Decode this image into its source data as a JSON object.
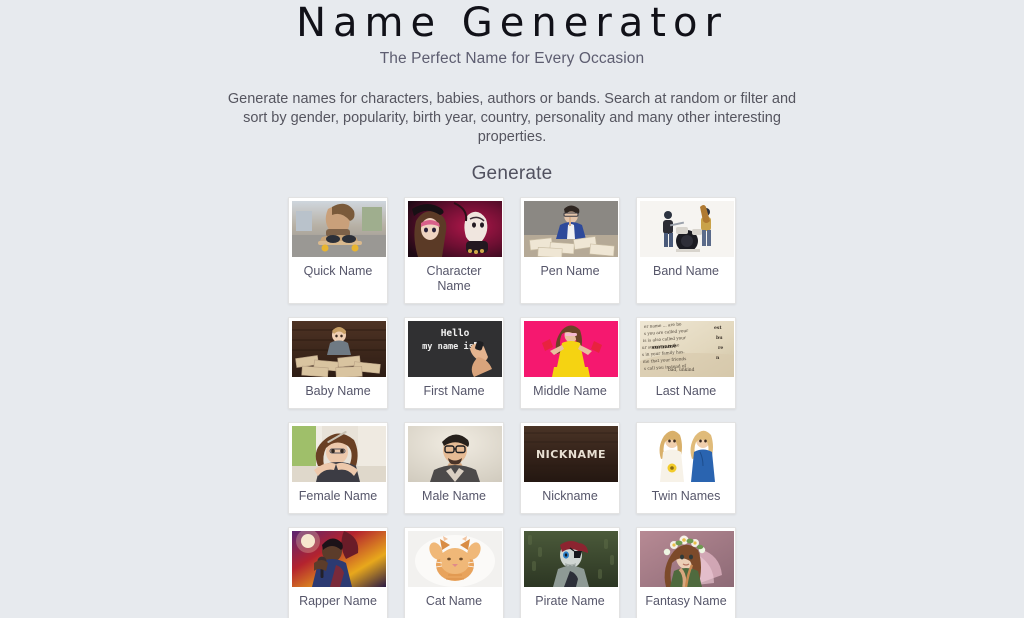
{
  "header": {
    "title": "Name Generator",
    "tagline": "The Perfect Name for Every Occasion",
    "intro": "Generate names for characters, babies, authors or bands. Search at random or filter and sort by gender, popularity, birth year, country, personality and many other interesting properties."
  },
  "section": {
    "title": "Generate"
  },
  "colors": {
    "page_background": "#e7eaee",
    "card_background": "#ffffff",
    "title_text": "#111118",
    "body_text": "#55555f",
    "label_text": "#56566a"
  },
  "cards": [
    {
      "label": "Quick Name",
      "image": "skateboarder-photo"
    },
    {
      "label": "Character Name",
      "image": "masquerade-woman-photo"
    },
    {
      "label": "Pen Name",
      "image": "writer-with-papers-photo"
    },
    {
      "label": "Band Name",
      "image": "band-playing-photo"
    },
    {
      "label": "Baby Name",
      "image": "baby-with-books-photo"
    },
    {
      "label": "First Name",
      "image": "hello-my-name-is-chalkboard-photo"
    },
    {
      "label": "Middle Name",
      "image": "woman-yellow-dress-pink-background-photo"
    },
    {
      "label": "Last Name",
      "image": "dictionary-surname-page-photo"
    },
    {
      "label": "Female Name",
      "image": "woman-with-pencil-photo"
    },
    {
      "label": "Male Name",
      "image": "man-with-glasses-photo"
    },
    {
      "label": "Nickname",
      "image": "nickname-wood-sign-photo"
    },
    {
      "label": "Twin Names",
      "image": "twin-sisters-photo"
    },
    {
      "label": "Rapper Name",
      "image": "rapper-with-microphone-photo"
    },
    {
      "label": "Cat Name",
      "image": "ginger-kitten-photo"
    },
    {
      "label": "Pirate Name",
      "image": "pirate-skeleton-photo"
    },
    {
      "label": "Fantasy Name",
      "image": "fairy-with-flower-crown-photo"
    }
  ]
}
